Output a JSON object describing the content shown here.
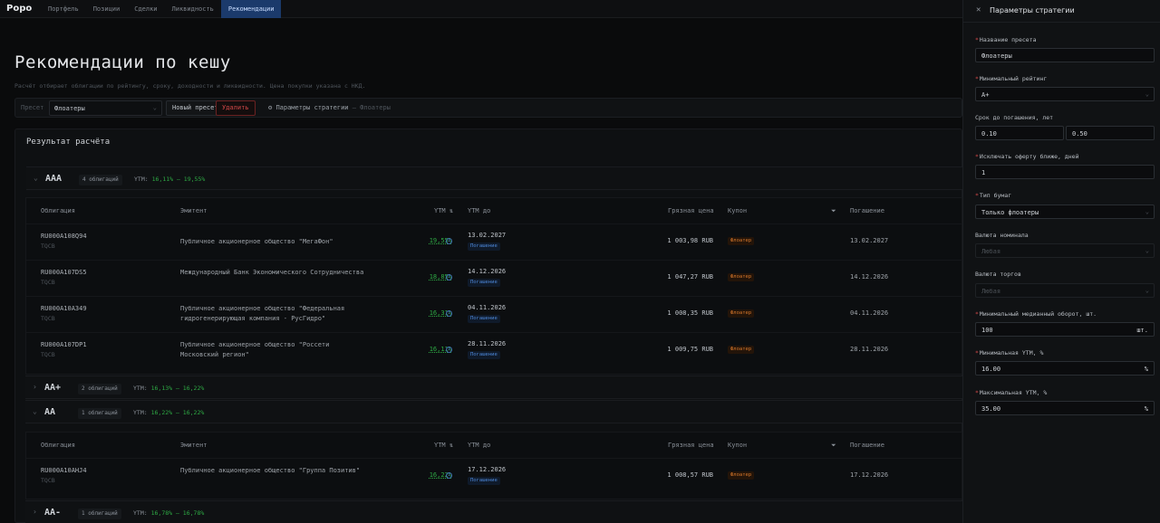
{
  "app": {
    "logo": "Popo"
  },
  "nav": [
    "Портфель",
    "Позиции",
    "Сделки",
    "Ликвидность",
    "Рекомендации"
  ],
  "page": {
    "title": "Рекомендации по кешу",
    "subtitle": "Расчёт отбирает облигации по рейтингу, сроку, доходности и ликвидности. Цена покупки указана с НКД."
  },
  "preset_bar": {
    "label": "Пресет",
    "selected": "Флоатеры",
    "new_button": "Новый пресет",
    "delete_button": "Удалить",
    "params_label": "Параметры стратегии",
    "params_suffix": "— Флоатеры"
  },
  "result": {
    "title": "Результат расчёта",
    "columns": [
      "Облигация",
      "Эмитент",
      "YTM",
      "YTM до",
      "Грязная цена",
      "Купон",
      "Погашение"
    ],
    "groups": [
      {
        "rating": "AAA",
        "count": "4 облигаций",
        "ytm_label": "YTM:",
        "ytm_range": "16,11% — 19,55%",
        "chevron": "⌄"
      },
      {
        "rating": "AA+",
        "count": "2 облигаций",
        "ytm_label": "YTM:",
        "ytm_range": "16,13% — 16,22%",
        "chevron": "›"
      },
      {
        "rating": "AA",
        "count": "1 облигаций",
        "ytm_label": "YTM:",
        "ytm_range": "16,22% — 16,22%",
        "chevron": "⌄"
      },
      {
        "rating": "AA-",
        "count": "1 облигаций",
        "ytm_label": "YTM:",
        "ytm_range": "16,78% — 16,78%",
        "chevron": "›"
      }
    ],
    "rows_aaa": [
      {
        "isin": "RU000A108Q94",
        "board": "TQCB",
        "emitter": "Публичное акционерное общество \"МегаФон\"",
        "ytm": "19,55%",
        "ytm_date": "13.02.2027",
        "ytm_tag": "Погашение",
        "price": "1 003,98 RUB",
        "coupon": "Флоатер",
        "maturity": "13.02.2027"
      },
      {
        "isin": "RU000A107DS5",
        "board": "TQCB",
        "emitter": "Международный Банк Экономического Сотрудничества",
        "ytm": "18,85%",
        "ytm_date": "14.12.2026",
        "ytm_tag": "Погашение",
        "price": "1 047,27 RUB",
        "coupon": "Флоатер",
        "maturity": "14.12.2026"
      },
      {
        "isin": "RU000A10A349",
        "board": "TQCB",
        "emitter": "Публичное акционерное общество \"Федеральная гидрогенерирующая компания - РусГидро\"",
        "ytm": "16,31%",
        "ytm_date": "04.11.2026",
        "ytm_tag": "Погашение",
        "price": "1 008,35 RUB",
        "coupon": "Флоатер",
        "maturity": "04.11.2026"
      },
      {
        "isin": "RU000A107DP1",
        "board": "TQCB",
        "emitter": "Публичное акционерное общество \"Россети Московский регион\"",
        "ytm": "16,11%",
        "ytm_date": "28.11.2026",
        "ytm_tag": "Погашение",
        "price": "1 009,75 RUB",
        "coupon": "Флоатер",
        "maturity": "28.11.2026"
      }
    ],
    "rows_aa": [
      {
        "isin": "RU000A10AHJ4",
        "board": "TQCB",
        "emitter": "Публичное акционерное общество \"Группа Позитив\"",
        "ytm": "16,22%",
        "ytm_date": "17.12.2026",
        "ytm_tag": "Погашение",
        "price": "1 008,57 RUB",
        "coupon": "Флоатер",
        "maturity": "17.12.2026"
      }
    ]
  },
  "panel": {
    "title": "Параметры стратегии",
    "fields": {
      "preset_name": {
        "label": "Название пресета",
        "value": "Флоатеры"
      },
      "min_rating": {
        "label": "Минимальный рейтинг",
        "value": "A+"
      },
      "term": {
        "label": "Срок до погашения, лет",
        "from": "0.10",
        "to": "0.50"
      },
      "offer": {
        "label": "Исключать оферту ближе, дней",
        "value": "1"
      },
      "bond_type": {
        "label": "Тип бумаг",
        "value": "Только флоатеры"
      },
      "nominal_currency": {
        "label": "Валюта номинала",
        "value": "Любая"
      },
      "trade_currency": {
        "label": "Валюта торгов",
        "value": "Любая"
      },
      "turnover": {
        "label": "Минимальный медианный оборот, шт.",
        "value": "100",
        "suffix": "шт."
      },
      "min_ytm": {
        "label": "Минимальная YTM, %",
        "value": "16.00",
        "suffix": "%"
      },
      "max_ytm": {
        "label": "Максимальная YTM, %",
        "value": "35.00",
        "suffix": "%"
      }
    }
  }
}
